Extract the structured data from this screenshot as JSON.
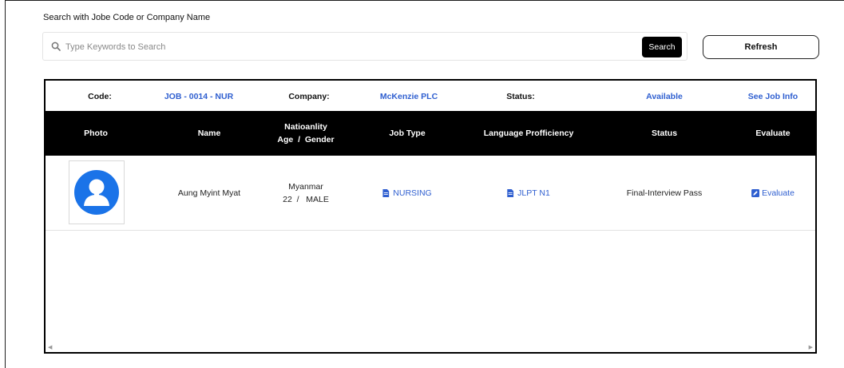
{
  "search": {
    "caption": "Search with Jobe Code or Company Name",
    "placeholder": "Type Keywords to Search",
    "value": "",
    "search_label": "Search",
    "refresh_label": "Refresh"
  },
  "job": {
    "code_label": "Code:",
    "code_value": "JOB - 0014 - NUR",
    "company_label": "Company:",
    "company_value": "McKenzie PLC",
    "status_label": "Status:",
    "status_value": "Available",
    "info_link": "See Job Info"
  },
  "table": {
    "headers": {
      "photo": "Photo",
      "name": "Name",
      "nationality_line": "Natioanlity",
      "age_gender_line": "Age  /  Gender",
      "job_type": "Job Type",
      "language": "Language Profficiency",
      "status": "Status",
      "evaluate": "Evaluate"
    },
    "rows": [
      {
        "name": "Aung Myint Myat",
        "nationality": "Myanmar",
        "age_gender": "22  /   MALE",
        "job_type": "NURSING",
        "language": "JLPT N1",
        "status": "Final-Interview Pass",
        "evaluate": "Evaluate"
      }
    ]
  },
  "colors": {
    "link": "#2f5fd0",
    "header_bg": "#000000",
    "avatar": "#1a73e8"
  },
  "icons": {
    "search": "search-icon",
    "document": "document-icon",
    "edit": "edit-icon",
    "avatar": "user-avatar-icon"
  }
}
